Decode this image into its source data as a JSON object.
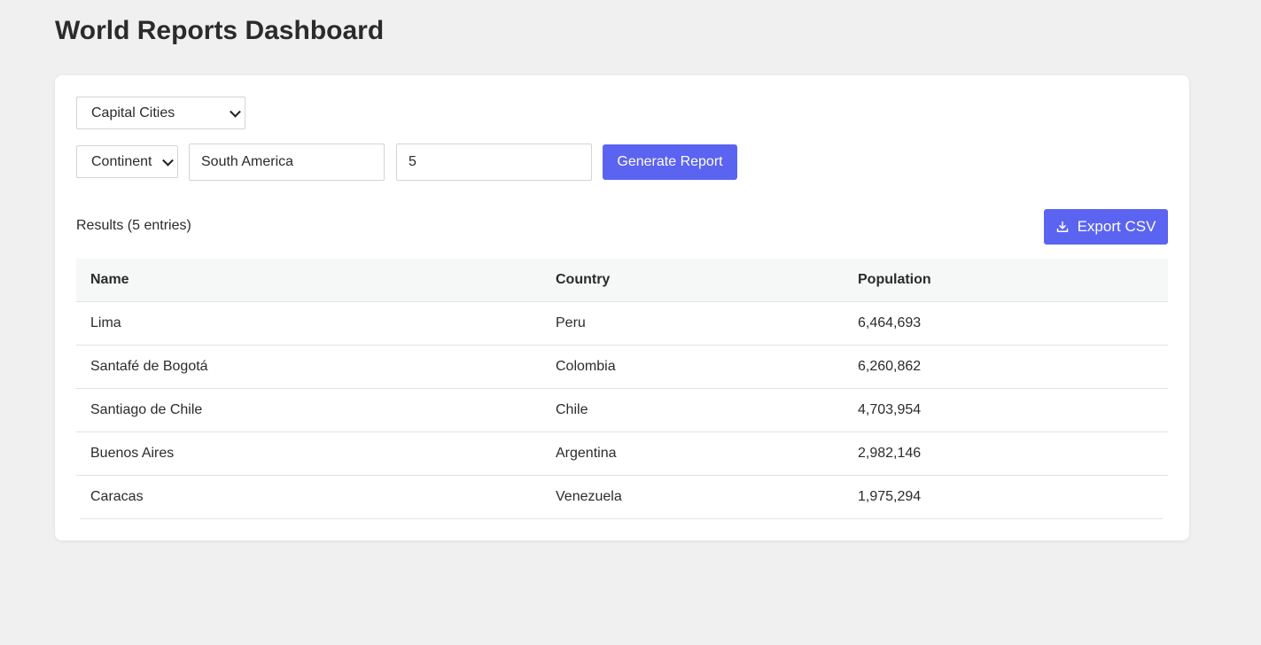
{
  "page": {
    "title": "World Reports Dashboard"
  },
  "controls": {
    "report_type": "Capital Cities",
    "filter_type": "Continent",
    "region_value": "South America",
    "limit_value": "5",
    "generate_label": "Generate Report"
  },
  "results": {
    "label": "Results (5 entries)",
    "export_label": "Export CSV",
    "export_icon": "download-icon",
    "columns": [
      "Name",
      "Country",
      "Population"
    ],
    "rows": [
      {
        "name": "Lima",
        "country": "Peru",
        "population": "6,464,693"
      },
      {
        "name": "Santafé de Bogotá",
        "country": "Colombia",
        "population": "6,260,862"
      },
      {
        "name": "Santiago de Chile",
        "country": "Chile",
        "population": "4,703,954"
      },
      {
        "name": "Buenos Aires",
        "country": "Argentina",
        "population": "2,982,146"
      },
      {
        "name": "Caracas",
        "country": "Venezuela",
        "population": "1,975,294"
      }
    ]
  },
  "colors": {
    "accent": "#5b63f1",
    "background": "#f0f0f0",
    "card": "#ffffff",
    "header_row": "#f6f7f7"
  }
}
